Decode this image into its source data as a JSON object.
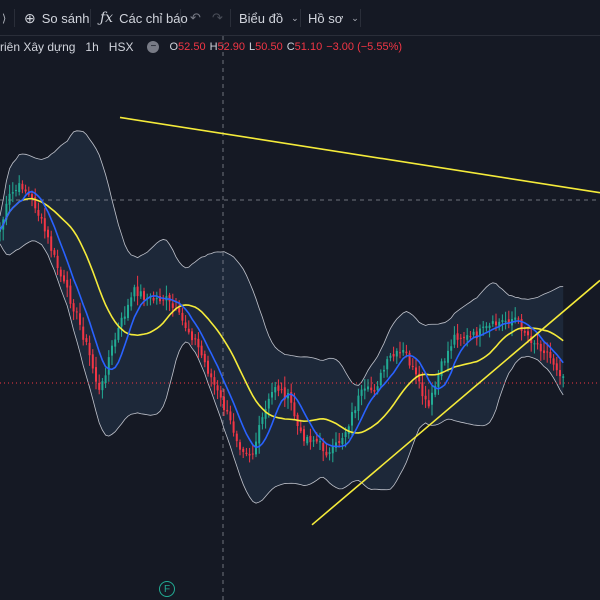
{
  "toolbar": {
    "fragment_icon": "chevron-fragment-icon",
    "compare_label": "So sánh",
    "indicators_label": "Các chỉ báo",
    "chart_menu_label": "Biểu đồ",
    "profile_menu_label": "Hồ sơ"
  },
  "legend": {
    "symbol": "riên Xây dựng",
    "interval": "1h",
    "exchange": "HSX",
    "open_key": "O",
    "open": "52.50",
    "high_key": "H",
    "high": "52.90",
    "low_key": "L",
    "low": "50.50",
    "close_key": "C",
    "close": "51.10",
    "change": "−3.00 (−5.55%)"
  },
  "markers": {
    "f_badge": "F"
  },
  "colors": {
    "up": "#22ab94",
    "down": "#f23645",
    "fast_ma": "#2962ff",
    "slow_ma": "#f5eb3a",
    "bands": "#c0c3cc",
    "trendline": "#f5eb3a",
    "background": "#151924"
  },
  "chart_data": {
    "type": "candlestick",
    "price_range": [
      48.5,
      57.5
    ],
    "trendlines": [
      {
        "from": [
          20,
          56.2
        ],
        "to": [
          100,
          55.0
        ]
      },
      {
        "from": [
          52,
          49.7
        ],
        "to": [
          100,
          53.6
        ]
      }
    ]
  }
}
